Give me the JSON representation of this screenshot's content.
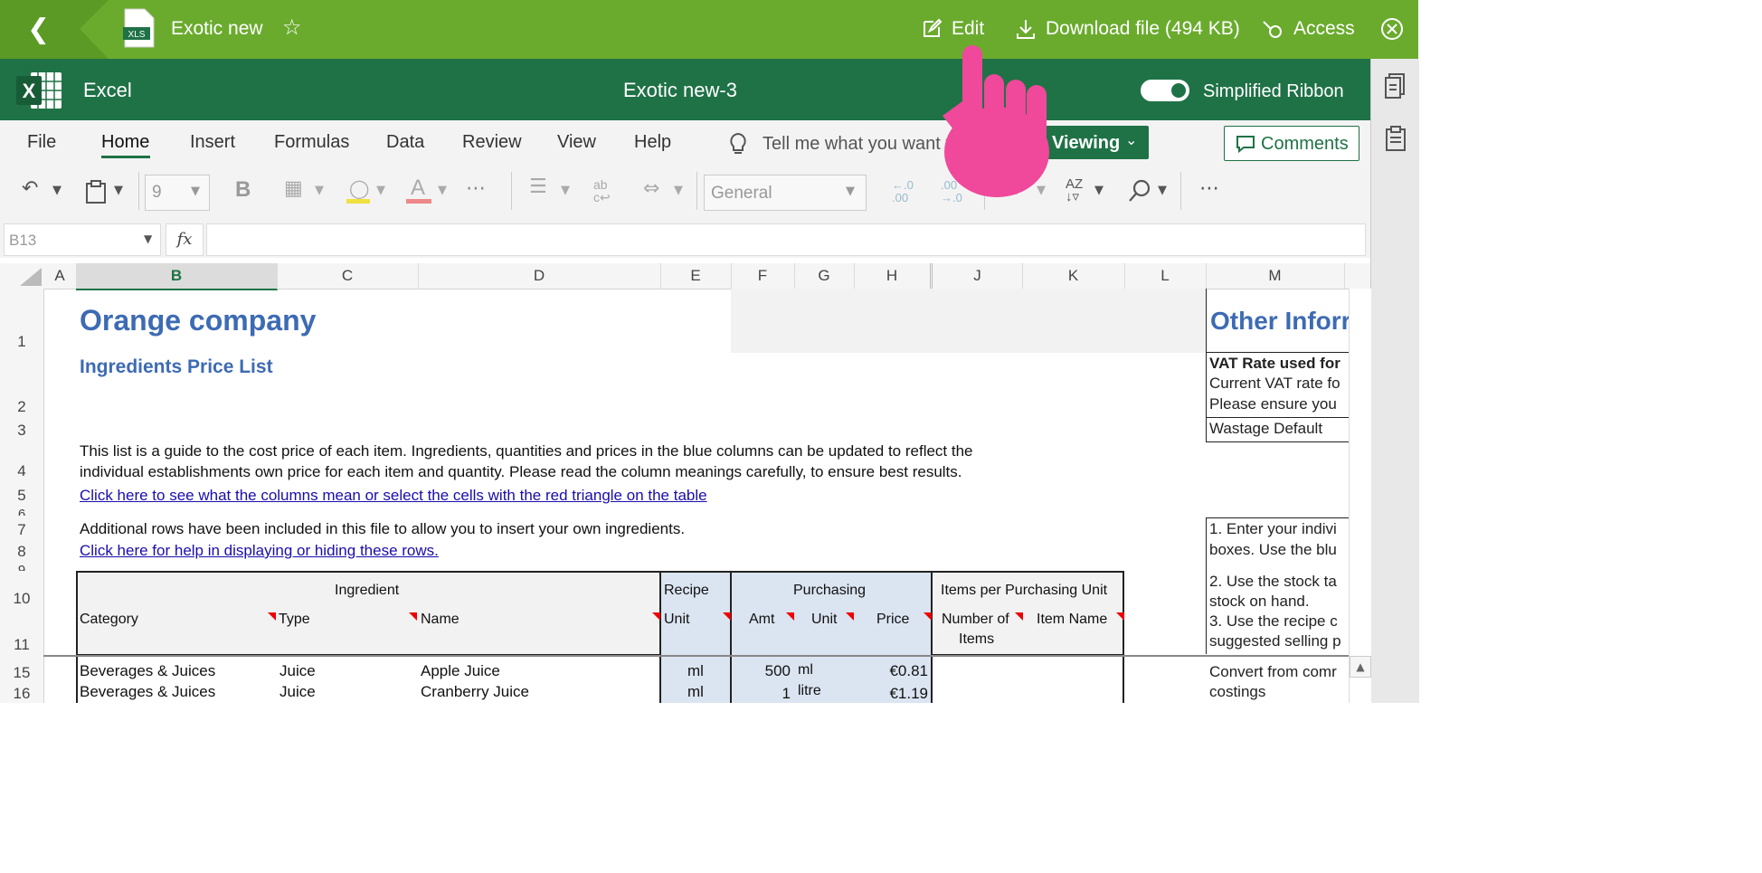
{
  "viewer": {
    "file_name": "Exotic new",
    "file_badge": "XLS",
    "edit_label": "Edit",
    "download_label": "Download file (494 KB)",
    "access_label": "Access"
  },
  "excel": {
    "app_name": "Excel",
    "doc_title": "Exotic new-3",
    "ribbon_toggle_label": "Simplified Ribbon"
  },
  "ribbon": {
    "tabs": [
      "File",
      "Home",
      "Insert",
      "Formulas",
      "Data",
      "Review",
      "View",
      "Help"
    ],
    "active_tab": "Home",
    "tell_me": "Tell me what you want t",
    "viewing_label": "Viewing",
    "comments_label": "Comments",
    "font_size": "9",
    "number_format": "General"
  },
  "formula_bar": {
    "name_box": "B13",
    "fx": "fx",
    "content": ""
  },
  "grid": {
    "columns": [
      "A",
      "B",
      "C",
      "D",
      "E",
      "F",
      "G",
      "H",
      "J",
      "K",
      "L",
      "M"
    ],
    "rows": [
      "1",
      "2",
      "3",
      "4",
      "5",
      "6",
      "7",
      "8",
      "9",
      "10",
      "11",
      "15",
      "16"
    ],
    "title": "Orange company",
    "subtitle": "Ingredients Price List",
    "intro_line1": "This list is a guide to the cost price of each item. Ingredients, quantities and prices in the blue columns can be updated to reflect the",
    "intro_line2": "individual establishments own price for each item and quantity.  Please read the column meanings carefully, to ensure best results.",
    "link1": "Click here to see what the columns mean or select the cells with the red triangle on the table",
    "additional_rows": "Additional rows have been included in this file to allow you to insert your own ingredients.",
    "link2": "Click here for help in displaying or hiding these rows.",
    "other_info_title": "Other Inforr",
    "vat_title": "VAT Rate used for",
    "vat_line1": "Current VAT rate fo",
    "vat_line2": "Please ensure you",
    "wastage": "Wastage Default",
    "step1a": "1. Enter your indivi",
    "step1b": "boxes. Use the blu",
    "step2a": "2. Use the stock ta",
    "step2b": "stock on hand.",
    "step3a": "3. Use the recipe c",
    "step3b": "suggested selling p",
    "convert_a": "Convert from comr",
    "convert_b": "costings"
  },
  "table": {
    "group_ingredient": "Ingredient",
    "group_recipe": "Recipe",
    "group_purchasing": "Purchasing",
    "group_items": "Items per Purchasing Unit",
    "headers": {
      "category": "Category",
      "type": "Type",
      "name": "Name",
      "unit": "Unit",
      "amt": "Amt",
      "p_unit": "Unit",
      "price": "Price",
      "number_of": "Number of",
      "items": "Items",
      "item_name": "Item Name"
    },
    "rows": [
      {
        "category": "Beverages & Juices",
        "type": "Juice",
        "name": "Apple Juice",
        "recipe_unit": "ml",
        "amt": "500",
        "p_unit": "ml",
        "price": "€0.81"
      },
      {
        "category": "Beverages & Juices",
        "type": "Juice",
        "name": "Cranberry Juice",
        "recipe_unit": "ml",
        "amt": "1",
        "p_unit": "litre",
        "price": "€1.19"
      }
    ]
  }
}
